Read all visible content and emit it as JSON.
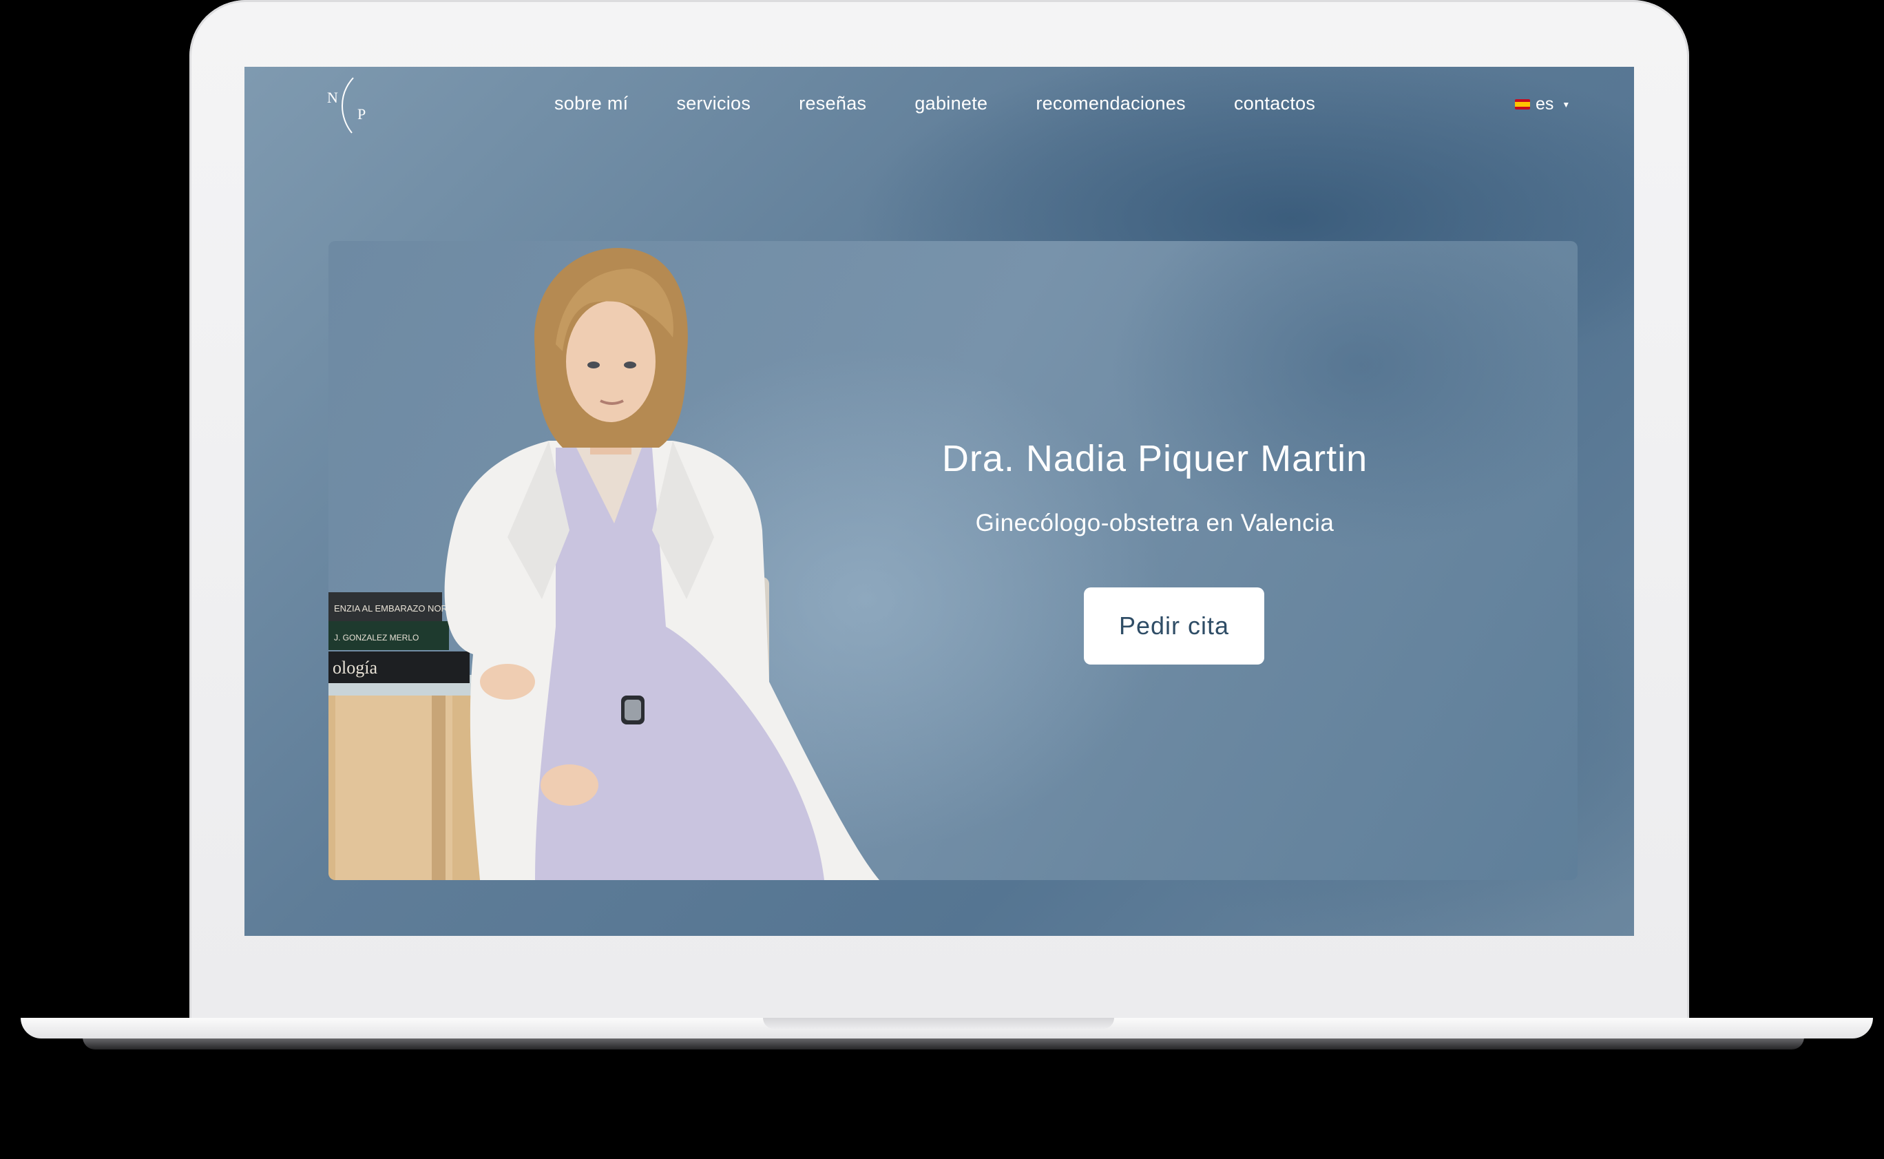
{
  "site": {
    "logo_letters": [
      "N",
      "P"
    ],
    "nav": {
      "items": [
        {
          "label": "sobre mí"
        },
        {
          "label": "servicios"
        },
        {
          "label": "reseñas"
        },
        {
          "label": "gabinete"
        },
        {
          "label": "recomendaciones"
        },
        {
          "label": "contactos"
        }
      ],
      "language": {
        "label": "es",
        "flag": "spain-flag-icon"
      }
    },
    "hero": {
      "title": "Dra. Nadia Piquer Martin",
      "subtitle": "Ginecólogo-obstetra en Valencia",
      "cta_label": "Pedir cita",
      "photo": "doctor-portrait",
      "book_labels": [
        "ENZIA AL EMBARAZO NORMAL",
        "J. GONZALEZ MERLO",
        "ología"
      ]
    }
  },
  "colors": {
    "screen_bg": "#5f7d98",
    "cta_bg": "#ffffff",
    "cta_text": "#2f4d66",
    "text": "#ffffff"
  }
}
